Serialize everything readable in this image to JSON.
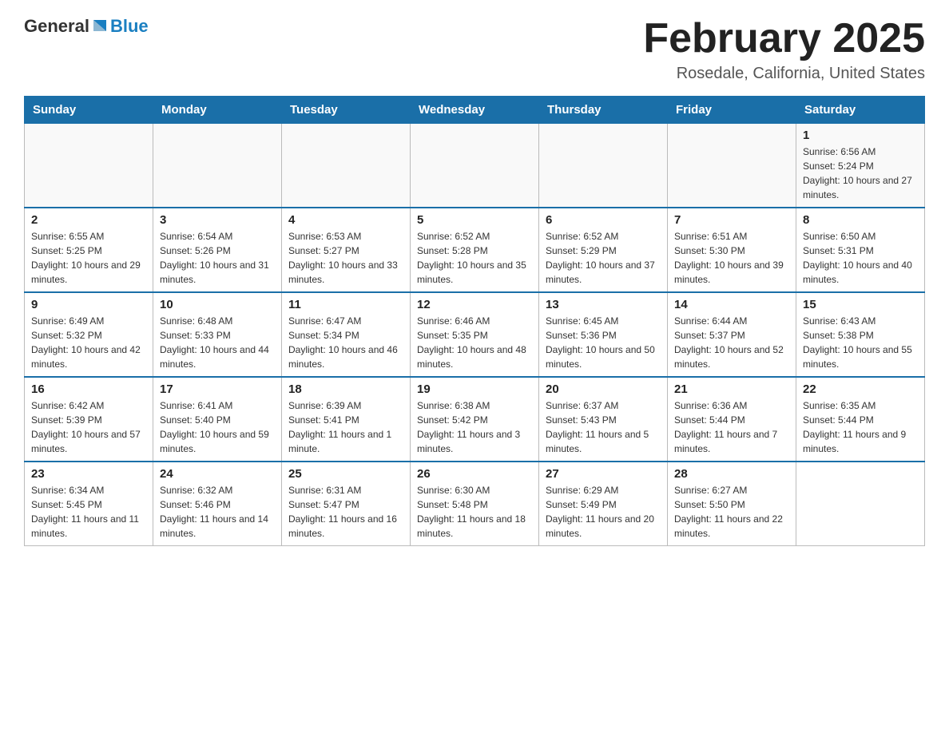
{
  "header": {
    "logo_general": "General",
    "logo_blue": "Blue",
    "title": "February 2025",
    "subtitle": "Rosedale, California, United States"
  },
  "days_of_week": [
    "Sunday",
    "Monday",
    "Tuesday",
    "Wednesday",
    "Thursday",
    "Friday",
    "Saturday"
  ],
  "weeks": [
    [
      {
        "day": "",
        "info": ""
      },
      {
        "day": "",
        "info": ""
      },
      {
        "day": "",
        "info": ""
      },
      {
        "day": "",
        "info": ""
      },
      {
        "day": "",
        "info": ""
      },
      {
        "day": "",
        "info": ""
      },
      {
        "day": "1",
        "info": "Sunrise: 6:56 AM\nSunset: 5:24 PM\nDaylight: 10 hours and 27 minutes."
      }
    ],
    [
      {
        "day": "2",
        "info": "Sunrise: 6:55 AM\nSunset: 5:25 PM\nDaylight: 10 hours and 29 minutes."
      },
      {
        "day": "3",
        "info": "Sunrise: 6:54 AM\nSunset: 5:26 PM\nDaylight: 10 hours and 31 minutes."
      },
      {
        "day": "4",
        "info": "Sunrise: 6:53 AM\nSunset: 5:27 PM\nDaylight: 10 hours and 33 minutes."
      },
      {
        "day": "5",
        "info": "Sunrise: 6:52 AM\nSunset: 5:28 PM\nDaylight: 10 hours and 35 minutes."
      },
      {
        "day": "6",
        "info": "Sunrise: 6:52 AM\nSunset: 5:29 PM\nDaylight: 10 hours and 37 minutes."
      },
      {
        "day": "7",
        "info": "Sunrise: 6:51 AM\nSunset: 5:30 PM\nDaylight: 10 hours and 39 minutes."
      },
      {
        "day": "8",
        "info": "Sunrise: 6:50 AM\nSunset: 5:31 PM\nDaylight: 10 hours and 40 minutes."
      }
    ],
    [
      {
        "day": "9",
        "info": "Sunrise: 6:49 AM\nSunset: 5:32 PM\nDaylight: 10 hours and 42 minutes."
      },
      {
        "day": "10",
        "info": "Sunrise: 6:48 AM\nSunset: 5:33 PM\nDaylight: 10 hours and 44 minutes."
      },
      {
        "day": "11",
        "info": "Sunrise: 6:47 AM\nSunset: 5:34 PM\nDaylight: 10 hours and 46 minutes."
      },
      {
        "day": "12",
        "info": "Sunrise: 6:46 AM\nSunset: 5:35 PM\nDaylight: 10 hours and 48 minutes."
      },
      {
        "day": "13",
        "info": "Sunrise: 6:45 AM\nSunset: 5:36 PM\nDaylight: 10 hours and 50 minutes."
      },
      {
        "day": "14",
        "info": "Sunrise: 6:44 AM\nSunset: 5:37 PM\nDaylight: 10 hours and 52 minutes."
      },
      {
        "day": "15",
        "info": "Sunrise: 6:43 AM\nSunset: 5:38 PM\nDaylight: 10 hours and 55 minutes."
      }
    ],
    [
      {
        "day": "16",
        "info": "Sunrise: 6:42 AM\nSunset: 5:39 PM\nDaylight: 10 hours and 57 minutes."
      },
      {
        "day": "17",
        "info": "Sunrise: 6:41 AM\nSunset: 5:40 PM\nDaylight: 10 hours and 59 minutes."
      },
      {
        "day": "18",
        "info": "Sunrise: 6:39 AM\nSunset: 5:41 PM\nDaylight: 11 hours and 1 minute."
      },
      {
        "day": "19",
        "info": "Sunrise: 6:38 AM\nSunset: 5:42 PM\nDaylight: 11 hours and 3 minutes."
      },
      {
        "day": "20",
        "info": "Sunrise: 6:37 AM\nSunset: 5:43 PM\nDaylight: 11 hours and 5 minutes."
      },
      {
        "day": "21",
        "info": "Sunrise: 6:36 AM\nSunset: 5:44 PM\nDaylight: 11 hours and 7 minutes."
      },
      {
        "day": "22",
        "info": "Sunrise: 6:35 AM\nSunset: 5:44 PM\nDaylight: 11 hours and 9 minutes."
      }
    ],
    [
      {
        "day": "23",
        "info": "Sunrise: 6:34 AM\nSunset: 5:45 PM\nDaylight: 11 hours and 11 minutes."
      },
      {
        "day": "24",
        "info": "Sunrise: 6:32 AM\nSunset: 5:46 PM\nDaylight: 11 hours and 14 minutes."
      },
      {
        "day": "25",
        "info": "Sunrise: 6:31 AM\nSunset: 5:47 PM\nDaylight: 11 hours and 16 minutes."
      },
      {
        "day": "26",
        "info": "Sunrise: 6:30 AM\nSunset: 5:48 PM\nDaylight: 11 hours and 18 minutes."
      },
      {
        "day": "27",
        "info": "Sunrise: 6:29 AM\nSunset: 5:49 PM\nDaylight: 11 hours and 20 minutes."
      },
      {
        "day": "28",
        "info": "Sunrise: 6:27 AM\nSunset: 5:50 PM\nDaylight: 11 hours and 22 minutes."
      },
      {
        "day": "",
        "info": ""
      }
    ]
  ]
}
